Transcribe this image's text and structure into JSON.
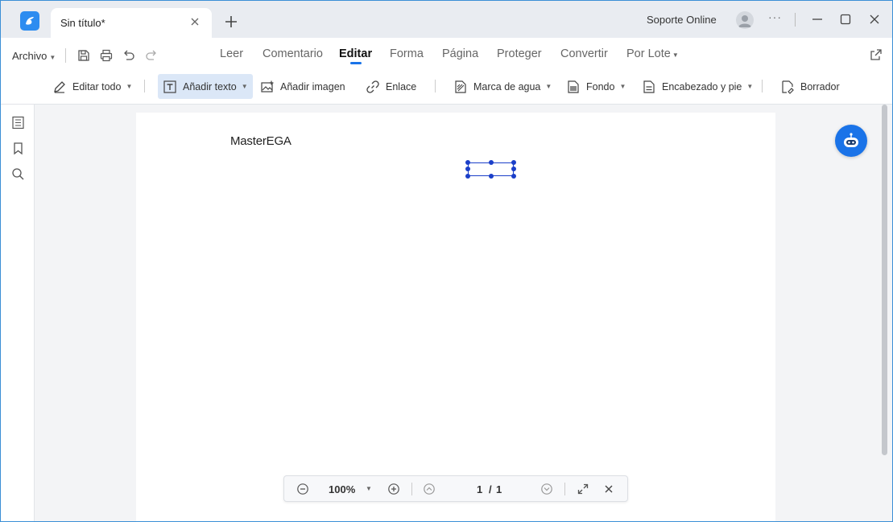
{
  "titlebar": {
    "tab_title": "Sin título*",
    "support_label": "Soporte Online",
    "more_label": "···"
  },
  "menubar": {
    "file_label": "Archivo",
    "tabs": [
      {
        "label": "Leer"
      },
      {
        "label": "Comentario"
      },
      {
        "label": "Editar"
      },
      {
        "label": "Forma"
      },
      {
        "label": "Página"
      },
      {
        "label": "Proteger"
      },
      {
        "label": "Convertir"
      },
      {
        "label": "Por Lote"
      }
    ],
    "active_tab": "Editar"
  },
  "toolbar": {
    "items": [
      {
        "label": "Editar todo",
        "icon": "pen-icon"
      },
      {
        "label": "Añadir texto",
        "icon": "text-box-icon"
      },
      {
        "label": "Añadir imagen",
        "icon": "image-icon"
      },
      {
        "label": "Enlace",
        "icon": "link-icon"
      },
      {
        "label": "Marca de agua",
        "icon": "watermark-icon"
      },
      {
        "label": "Fondo",
        "icon": "background-icon"
      },
      {
        "label": "Encabezado y pie",
        "icon": "header-footer-icon"
      },
      {
        "label": "Borrador",
        "icon": "eraser-icon"
      }
    ]
  },
  "document": {
    "text": "MasterEGA"
  },
  "zoombar": {
    "zoom": "100%",
    "current_page": "1",
    "separator": "/",
    "total_pages": "1"
  },
  "colors": {
    "accent": "#1a73e8",
    "selection": "#1b3fc9",
    "active_tool_bg": "#dbe7f7"
  }
}
